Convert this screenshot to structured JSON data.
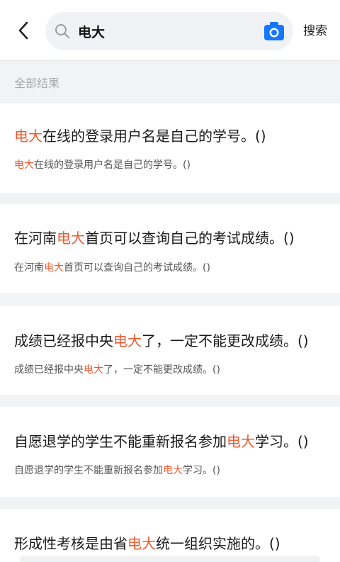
{
  "header": {
    "back_icon": "chevron-left-icon",
    "search_value": "电大",
    "search_icon": "search-icon",
    "camera_icon": "camera-icon",
    "search_button": "搜索",
    "accent": "#1677ff"
  },
  "section_label": "全部结果",
  "highlight_color": "#ef5a2e",
  "results": [
    {
      "title": {
        "pre": "",
        "hl": "电大",
        "post": "在线的登录用户名是自己的学号。()"
      },
      "sub": {
        "pre": "",
        "hl": "电大",
        "post": "在线的登录用户名是自己的学号。()"
      }
    },
    {
      "title": {
        "pre": "在河南",
        "hl": "电大",
        "post": "首页可以查询自己的考试成绩。()"
      },
      "sub": {
        "pre": "在河南",
        "hl": "电大",
        "post": "首页可以查询自己的考试成绩。()"
      }
    },
    {
      "title": {
        "pre": "成绩已经报中央",
        "hl": "电大",
        "post": "了，一定不能更改成绩。()"
      },
      "sub": {
        "pre": "成绩已经报中央",
        "hl": "电大",
        "post": "了，一定不能更改成绩。()"
      }
    },
    {
      "title": {
        "pre": "自愿退学的学生不能重新报名参加",
        "hl": "电大",
        "post": "学习。()"
      },
      "sub": {
        "pre": "自愿退学的学生不能重新报名参加",
        "hl": "电大",
        "post": "学习。()"
      }
    },
    {
      "title": {
        "pre": "形成性考核是由省",
        "hl": "电大",
        "post": "统一组织实施的。()"
      }
    }
  ]
}
